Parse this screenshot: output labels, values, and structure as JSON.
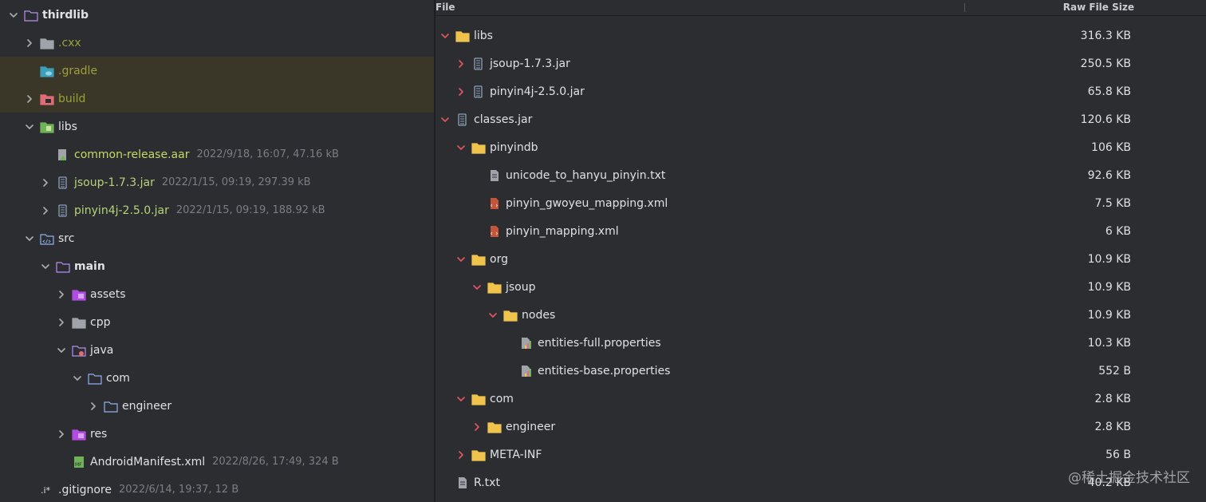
{
  "project_tree": {
    "rows": [
      {
        "name": "thirdlib",
        "meta": "",
        "chevron": "down",
        "icon": "module-folder-icon",
        "style": "bold",
        "highlight": false,
        "indent": 0
      },
      {
        "name": ".cxx",
        "meta": "",
        "chevron": "right",
        "icon": "folder-gray-icon",
        "style": "olive",
        "highlight": false,
        "indent": 1
      },
      {
        "name": ".gradle",
        "meta": "",
        "chevron": "none",
        "icon": "gradle-folder-icon",
        "style": "olive",
        "highlight": true,
        "indent": 1
      },
      {
        "name": "build",
        "meta": "",
        "chevron": "right",
        "icon": "build-folder-icon",
        "style": "olive",
        "highlight": true,
        "indent": 1
      },
      {
        "name": "libs",
        "meta": "",
        "chevron": "down",
        "icon": "libs-folder-icon",
        "style": "default",
        "highlight": false,
        "indent": 1
      },
      {
        "name": "common-release.aar",
        "meta": "2022/9/18, 16:07, 47.16 kB",
        "chevron": "none",
        "icon": "aar-file-icon",
        "style": "green",
        "highlight": false,
        "indent": 2
      },
      {
        "name": "jsoup-1.7.3.jar",
        "meta": "2022/1/15, 09:19, 297.39 kB",
        "chevron": "right",
        "icon": "jar-file-icon",
        "style": "lime",
        "highlight": false,
        "indent": 2
      },
      {
        "name": "pinyin4j-2.5.0.jar",
        "meta": "2022/1/15, 09:19, 188.92 kB",
        "chevron": "right",
        "icon": "jar-file-icon",
        "style": "lime",
        "highlight": false,
        "indent": 2
      },
      {
        "name": "src",
        "meta": "",
        "chevron": "down",
        "icon": "source-folder-icon",
        "style": "default",
        "highlight": false,
        "indent": 1
      },
      {
        "name": "main",
        "meta": "",
        "chevron": "down",
        "icon": "module-folder-icon",
        "style": "bold",
        "highlight": false,
        "indent": 2
      },
      {
        "name": "assets",
        "meta": "",
        "chevron": "right",
        "icon": "assets-folder-icon",
        "style": "default",
        "highlight": false,
        "indent": 3
      },
      {
        "name": "cpp",
        "meta": "",
        "chevron": "right",
        "icon": "folder-gray-icon",
        "style": "default",
        "highlight": false,
        "indent": 3
      },
      {
        "name": "java",
        "meta": "",
        "chevron": "down",
        "icon": "java-folder-icon",
        "style": "default",
        "highlight": false,
        "indent": 3
      },
      {
        "name": "com",
        "meta": "",
        "chevron": "down",
        "icon": "package-folder-icon",
        "style": "default",
        "highlight": false,
        "indent": 4
      },
      {
        "name": "engineer",
        "meta": "",
        "chevron": "right",
        "icon": "package-folder-icon",
        "style": "default",
        "highlight": false,
        "indent": 5
      },
      {
        "name": "res",
        "meta": "",
        "chevron": "right",
        "icon": "res-folder-icon",
        "style": "default",
        "highlight": false,
        "indent": 3
      },
      {
        "name": "AndroidManifest.xml",
        "meta": "2022/8/26, 17:49, 324 B",
        "chevron": "none",
        "icon": "manifest-file-icon",
        "style": "default",
        "highlight": false,
        "indent": 3
      },
      {
        "name": ".gitignore",
        "meta": "2022/6/14, 19:37, 12 B",
        "chevron": "none",
        "icon": "gitignore-file-icon",
        "style": "default",
        "highlight": false,
        "indent": 1
      }
    ]
  },
  "analyzer": {
    "header": {
      "file_label": "File",
      "size_label": "Raw File Size"
    },
    "rows": [
      {
        "name": "libs",
        "size": "316.3 KB",
        "chevron": "down",
        "icon": "folder-yellow-icon",
        "indent": 0
      },
      {
        "name": "jsoup-1.7.3.jar",
        "size": "250.5 KB",
        "chevron": "right",
        "icon": "jar-file-icon",
        "indent": 1
      },
      {
        "name": "pinyin4j-2.5.0.jar",
        "size": "65.8 KB",
        "chevron": "right",
        "icon": "jar-file-icon",
        "indent": 1
      },
      {
        "name": "classes.jar",
        "size": "120.6 KB",
        "chevron": "down",
        "icon": "jar-file-icon",
        "indent": 0
      },
      {
        "name": "pinyindb",
        "size": "106 KB",
        "chevron": "down",
        "icon": "folder-yellow-icon",
        "indent": 1
      },
      {
        "name": "unicode_to_hanyu_pinyin.txt",
        "size": "92.6 KB",
        "chevron": "none",
        "icon": "text-file-icon",
        "indent": 2
      },
      {
        "name": "pinyin_gwoyeu_mapping.xml",
        "size": "7.5 KB",
        "chevron": "none",
        "icon": "xml-file-icon",
        "indent": 2
      },
      {
        "name": "pinyin_mapping.xml",
        "size": "6 KB",
        "chevron": "none",
        "icon": "xml-file-icon",
        "indent": 2
      },
      {
        "name": "org",
        "size": "10.9 KB",
        "chevron": "down",
        "icon": "folder-yellow-icon",
        "indent": 1
      },
      {
        "name": "jsoup",
        "size": "10.9 KB",
        "chevron": "down",
        "icon": "folder-yellow-icon",
        "indent": 2
      },
      {
        "name": "nodes",
        "size": "10.9 KB",
        "chevron": "down",
        "icon": "folder-yellow-icon",
        "indent": 3
      },
      {
        "name": "entities-full.properties",
        "size": "10.3 KB",
        "chevron": "none",
        "icon": "properties-file-icon",
        "indent": 4
      },
      {
        "name": "entities-base.properties",
        "size": "552 B",
        "chevron": "none",
        "icon": "properties-file-icon",
        "indent": 4
      },
      {
        "name": "com",
        "size": "2.8 KB",
        "chevron": "down",
        "icon": "folder-yellow-icon",
        "indent": 1
      },
      {
        "name": "engineer",
        "size": "2.8 KB",
        "chevron": "right",
        "icon": "folder-yellow-icon",
        "indent": 2
      },
      {
        "name": "META-INF",
        "size": "56 B",
        "chevron": "right",
        "icon": "folder-yellow-icon",
        "indent": 1
      },
      {
        "name": "R.txt",
        "size": "40.2 KB",
        "chevron": "none",
        "icon": "text-file-icon",
        "indent": 0
      }
    ]
  },
  "watermark": "@稀土掘金技术社区",
  "colors": {
    "background": "#2b2d30",
    "highlight_row": "#3a3628",
    "chevron_analyzer": "#e05561",
    "chevron_tree": "#a8abb1",
    "folder_yellow": "#f0c44c"
  }
}
